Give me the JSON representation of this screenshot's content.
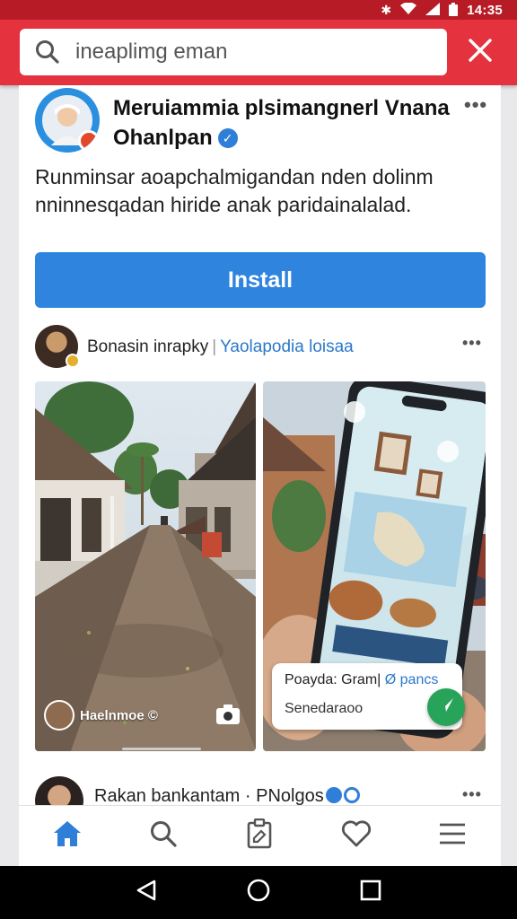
{
  "status_bar": {
    "time": "14:35",
    "icons": [
      "bluetooth-icon",
      "wifi-icon",
      "signal-icon",
      "battery-icon"
    ]
  },
  "search": {
    "value": "ineaplimg eman",
    "icon": "search-icon",
    "close_icon": "close-icon"
  },
  "ad": {
    "title": "Meruiammia plsimangnerl Vnana Ohanlpan",
    "verified_glyph": "✓",
    "body": "Runminsar aoapchalmigandan nden dolinm nninnesqadan hiride anak paridainalalad.",
    "install_label": "Install",
    "more_icon": "more-horizontal-icon"
  },
  "post": {
    "author": "Bonasin inrapky",
    "separator": "|",
    "group": "Yaolapodia loisaa",
    "more_icon": "more-horizontal-icon",
    "left_photo_caption": "Haelnmoe ©",
    "camera_icon": "camera-icon",
    "overlay_line1_prefix": "Poayda: Gram|",
    "overlay_line1_highlight": "Ø pancs",
    "overlay_line2": "Senedaraoo",
    "send_icon": "send-icon"
  },
  "next_post": {
    "author": "Rakan bankantam · PNolgos",
    "more_icon": "more-horizontal-icon"
  },
  "tabs": [
    {
      "name": "home",
      "icon": "home-icon",
      "active": true
    },
    {
      "name": "search",
      "icon": "search-icon",
      "active": false
    },
    {
      "name": "clipboard",
      "icon": "clipboard-icon",
      "active": false
    },
    {
      "name": "favorites",
      "icon": "heart-icon",
      "active": false
    },
    {
      "name": "menu",
      "icon": "menu-icon",
      "active": false
    }
  ],
  "nav": [
    "back-icon",
    "home-circle-icon",
    "recents-icon"
  ],
  "colors": {
    "header_red": "#e5323f",
    "status_red": "#b71c26",
    "accent_blue": "#2f84de",
    "active_tab_blue": "#2f7fd8",
    "send_green": "#27a35a"
  }
}
